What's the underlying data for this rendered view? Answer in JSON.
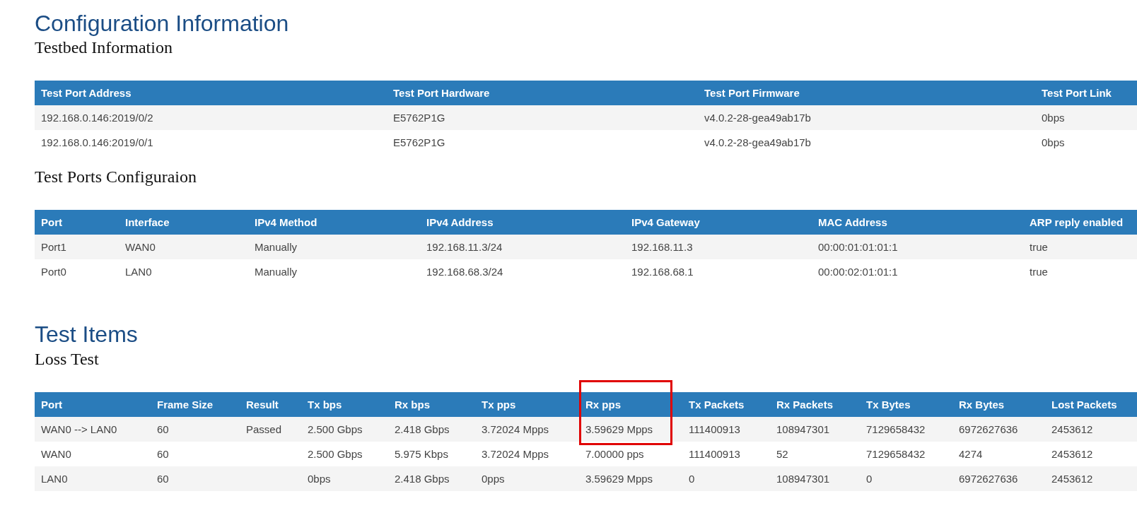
{
  "sections": [
    {
      "title": "Configuration Information",
      "subsections": [
        {
          "title": "Testbed Information",
          "table": {
            "columns": [
              {
                "label": "Test Port Address"
              },
              {
                "label": "Test Port Hardware"
              },
              {
                "label": "Test Port Firmware"
              },
              {
                "label": "Test Port Link"
              }
            ],
            "rows": [
              {
                "cells": [
                  "192.168.0.146:2019/0/2",
                  "E5762P1G",
                  "v4.0.2-28-gea49ab17b",
                  "0bps"
                ]
              },
              {
                "cells": [
                  "192.168.0.146:2019/0/1",
                  "E5762P1G",
                  "v4.0.2-28-gea49ab17b",
                  "0bps"
                ]
              }
            ]
          }
        },
        {
          "title": "Test Ports Configuraion",
          "table": {
            "columns": [
              {
                "label": "Port"
              },
              {
                "label": "Interface"
              },
              {
                "label": "IPv4 Method"
              },
              {
                "label": "IPv4 Address"
              },
              {
                "label": "IPv4 Gateway"
              },
              {
                "label": "MAC Address"
              },
              {
                "label": "ARP reply enabled"
              }
            ],
            "rows": [
              {
                "cells": [
                  "Port1",
                  "WAN0",
                  "Manually",
                  "192.168.11.3/24",
                  "192.168.11.3",
                  "00:00:01:01:01:1",
                  "true"
                ]
              },
              {
                "cells": [
                  "Port0",
                  "LAN0",
                  "Manually",
                  "192.168.68.3/24",
                  "192.168.68.1",
                  "00:00:02:01:01:1",
                  "true"
                ]
              }
            ]
          }
        }
      ]
    },
    {
      "title": "Test Items",
      "subsections": [
        {
          "title": "Loss Test",
          "table": {
            "columns": [
              {
                "label": "Port",
                "highlighted": false
              },
              {
                "label": "Frame Size",
                "highlighted": false
              },
              {
                "label": "Result",
                "highlighted": false
              },
              {
                "label": "Tx bps",
                "highlighted": false
              },
              {
                "label": "Rx bps",
                "highlighted": false
              },
              {
                "label": "Tx pps",
                "highlighted": false
              },
              {
                "label": "Rx pps",
                "highlighted": true
              },
              {
                "label": "Tx Packets",
                "highlighted": false
              },
              {
                "label": "Rx Packets",
                "highlighted": false
              },
              {
                "label": "Tx Bytes",
                "highlighted": false
              },
              {
                "label": "Rx Bytes",
                "highlighted": false
              },
              {
                "label": "Lost Packets",
                "highlighted": false
              }
            ],
            "rows": [
              {
                "cells": [
                  "WAN0 --> LAN0",
                  "60",
                  "Passed",
                  "2.500 Gbps",
                  "2.418 Gbps",
                  "3.72024 Mpps",
                  "3.59629 Mpps",
                  "111400913",
                  "108947301",
                  "7129658432",
                  "6972627636",
                  "2453612"
                ],
                "highlighted": true
              },
              {
                "cells": [
                  "WAN0",
                  "60",
                  null,
                  "2.500 Gbps",
                  "5.975 Kbps",
                  "3.72024 Mpps",
                  "7.00000 pps",
                  "111400913",
                  "52",
                  "7129658432",
                  "4274",
                  "2453612"
                ],
                "highlighted": false
              },
              {
                "cells": [
                  "LAN0",
                  "60",
                  null,
                  "0bps",
                  "2.418 Gbps",
                  "0pps",
                  "3.59629 Mpps",
                  "0",
                  "108947301",
                  "0",
                  "6972627636",
                  "2453612"
                ],
                "highlighted": false
              }
            ]
          }
        }
      ]
    }
  ]
}
